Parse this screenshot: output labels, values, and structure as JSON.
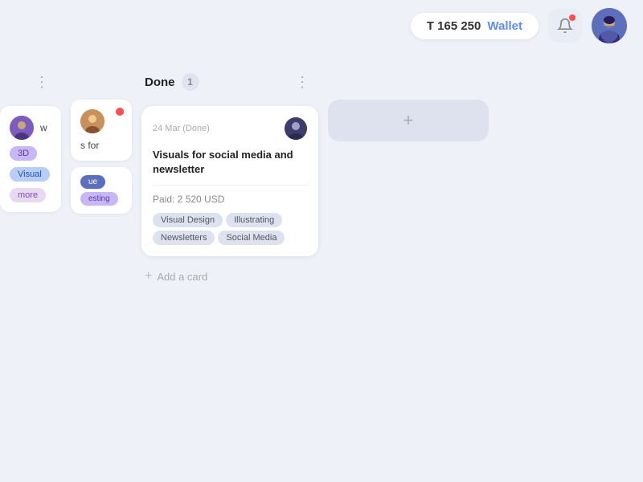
{
  "header": {
    "balance": "T 165 250",
    "wallet_label": "Wallet",
    "notification_icon": "bell-icon",
    "avatar_alt": "user-avatar"
  },
  "board": {
    "columns": [
      {
        "id": "partial-left",
        "three_dots": "⋮",
        "partial_cards": [
          {
            "avatar_color": "#7c5cbf",
            "title": "w",
            "tags": [
              "3D",
              "Visual"
            ],
            "more": "more"
          }
        ]
      },
      {
        "id": "done",
        "title": "Done",
        "count": "1",
        "cards": [
          {
            "date": "24 Mar (Done)",
            "title": "Visuals for social media and newsletter",
            "paid": "Paid: 2 520 USD",
            "tags": [
              "Visual Design",
              "Illustrating",
              "Newsletters",
              "Social Media"
            ]
          }
        ],
        "add_card_label": "Add a card"
      },
      {
        "id": "add-column",
        "add_icon": "+"
      }
    ],
    "partial_right": {
      "has_notification": true,
      "title": "s for",
      "tags": [
        "ue",
        "esting"
      ]
    }
  }
}
